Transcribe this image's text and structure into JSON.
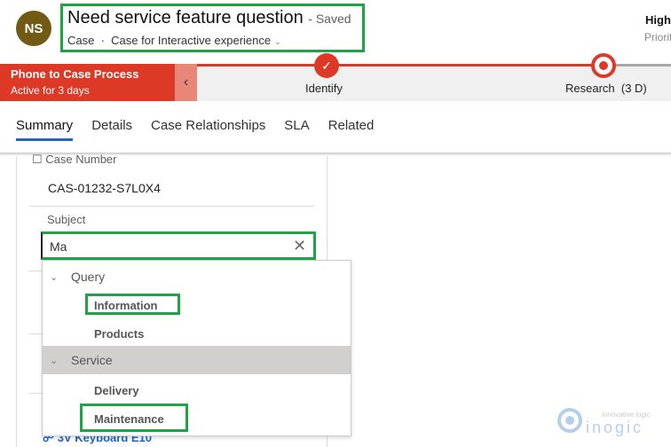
{
  "header": {
    "avatar_initials": "NS",
    "title": "Need service feature question",
    "save_status": "- Saved",
    "entity": "Case",
    "separator": "·",
    "form_name": "Case for Interactive experience",
    "priority_value": "High",
    "priority_label": "Priority"
  },
  "process": {
    "name": "Phone to Case Process",
    "active": "Active for 3 days",
    "stages": [
      {
        "label": "Identify",
        "status": "completed"
      },
      {
        "label": "Research  (3 D)",
        "status": "active"
      }
    ],
    "accent": "#dc3a26"
  },
  "tabs": [
    "Summary",
    "Details",
    "Case Relationships",
    "SLA",
    "Related"
  ],
  "form": {
    "case_number_label": "Case Number",
    "case_number": "CAS-01232-S7L0X4",
    "subject_label": "Subject",
    "subject_value": "Ma",
    "related_link": "3V Keyboard E10"
  },
  "dropdown": {
    "groups": [
      {
        "label": "Query",
        "items": [
          "Information",
          "Products"
        ]
      },
      {
        "label": "Service",
        "items": [
          "Delivery",
          "Maintenance"
        ]
      }
    ],
    "highlighted": [
      "Information",
      "Maintenance"
    ]
  },
  "watermark": {
    "tagline": "innovative logic",
    "brand": "inogic"
  }
}
